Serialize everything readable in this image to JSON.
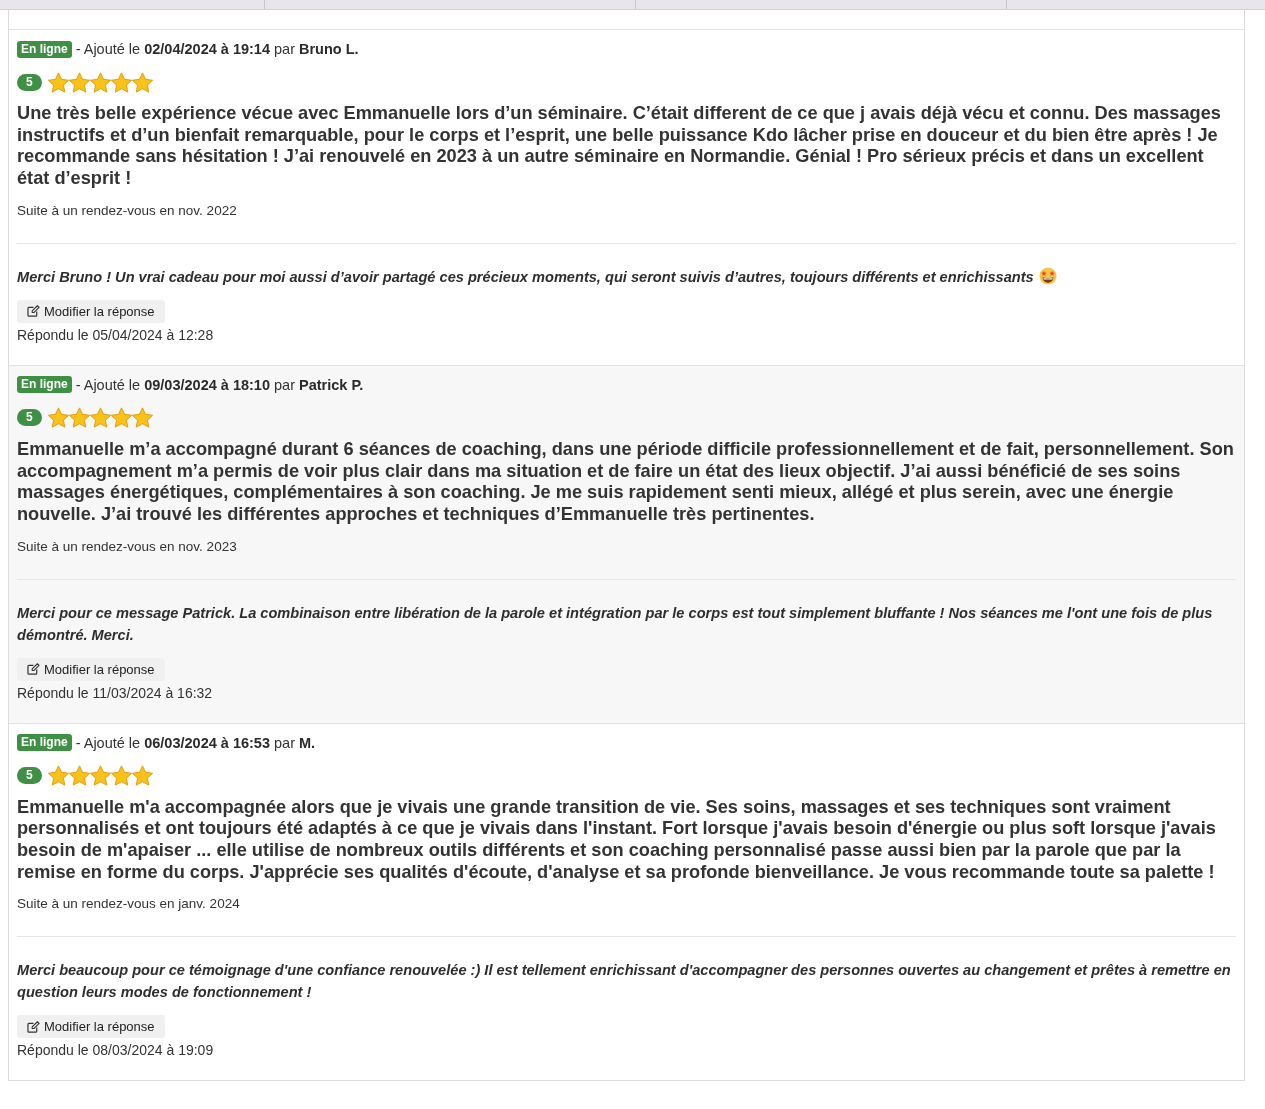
{
  "reviews": [
    {
      "status": "En ligne",
      "meta": "- Ajouté le **02/04/2024 à 19:14** par **Bruno L.**",
      "rating": "5",
      "stars": 5,
      "text": "Une très belle expérience vécue avec Emmanuelle lors d’un séminaire. C’était different de ce que j avais déjà vécu et connu. Des massages instructifs et d’un bienfait remarquable, pour le corps et l’esprit, une belle puissance Kdo lâcher prise en douceur et du bien être après ! Je recommande sans hésitation ! J’ai renouvelé en 2023 à un autre séminaire en Normandie. Génial ! Pro sérieux précis et dans un excellent état d’esprit !",
      "appointment": "Suite à un rendez-vous en nov. 2022",
      "reply": {
        "text": "Merci Bruno ! Un vrai cadeau pour moi aussi d’avoir partagé ces précieux moments, qui seront suivis d’autres, toujours différents et enrichissants",
        "emoji": true,
        "edit_button": "Modifier la réponse",
        "answered": "Répondu le 05/04/2024 à 12:28"
      }
    },
    {
      "status": "En ligne",
      "meta": "- Ajouté le **09/03/2024 à 18:10** par **Patrick P.**",
      "rating": "5",
      "stars": 5,
      "text": "Emmanuelle m’a accompagné durant 6 séances de coaching, dans une période difficile professionnellement et de fait, personnellement. Son accompagnement m’a permis de voir plus clair dans ma situation et de faire un état des lieux objectif. J’ai aussi bénéficié de ses soins massages énergétiques, complémentaires à son coaching. Je me suis rapidement senti mieux, allégé et plus serein, avec une énergie nouvelle. J’ai trouvé les différentes approches et techniques d’Emmanuelle très pertinentes.",
      "appointment": "Suite à un rendez-vous en nov. 2023",
      "reply": {
        "text": "Merci pour ce message Patrick. La combinaison entre libération de la parole et intégration par le corps est tout simplement bluffante ! Nos séances me l'ont une fois de plus démontré. Merci.",
        "emoji": false,
        "edit_button": "Modifier la réponse",
        "answered": "Répondu le 11/03/2024 à 16:32"
      }
    },
    {
      "status": "En ligne",
      "meta": "- Ajouté le **06/03/2024 à 16:53** par **M.**",
      "rating": "5",
      "stars": 5,
      "text": "Emmanuelle m'a accompagnée alors que je vivais une grande transition de vie. Ses soins, massages et ses techniques sont vraiment personnalisés et ont toujours été adaptés à ce que je vivais dans l'instant. Fort lorsque j'avais besoin d'énergie ou plus soft lorsque j'avais besoin de m'apaiser ... elle utilise de nombreux outils différents et son coaching personnalisé passe aussi bien par la parole que par la remise en forme du corps. J'apprécie ses qualités d'écoute, d'analyse et sa profonde bienveillance. Je vous recommande toute sa palette !",
      "appointment": "Suite à un rendez-vous en janv. 2024",
      "reply": {
        "text": "Merci beaucoup pour ce témoignage d'une confiance renouvelée :) Il est tellement enrichissant d'accompagner des personnes ouvertes au changement et prêtes à remettre en question leurs modes de fonctionnement !",
        "emoji": false,
        "edit_button": "Modifier la réponse",
        "answered": "Répondu le 08/03/2024 à 19:09"
      }
    }
  ]
}
